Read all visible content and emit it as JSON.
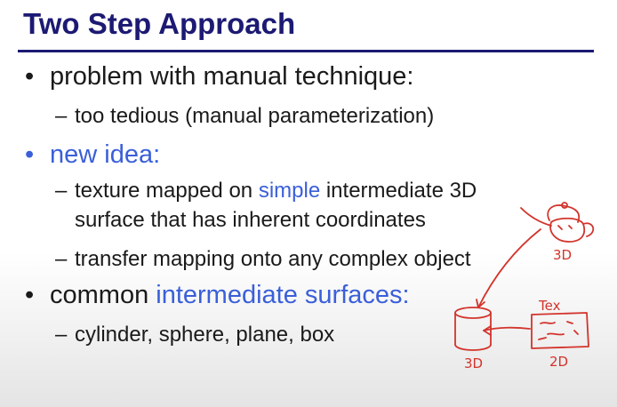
{
  "slide": {
    "title": "Two Step Approach",
    "bullets": [
      {
        "text": "problem with manual technique:",
        "subitems": [
          {
            "text": "too tedious (manual parameterization)"
          }
        ]
      },
      {
        "text": "new idea:",
        "subitems": [
          {
            "part1": "texture mapped on ",
            "highlight": "simple",
            "part2": " intermediate 3D",
            "line2": "surface that has inherent coordinates"
          },
          {
            "text": "transfer mapping onto any complex object"
          }
        ]
      },
      {
        "part1": "common ",
        "highlight": "intermediate surfaces:",
        "subitems": [
          {
            "text": "cylinder, sphere, plane, box"
          }
        ]
      }
    ],
    "colors": {
      "title": "#1c1a73",
      "highlight": "#3a5fd9",
      "annotation": "#d2342c"
    }
  },
  "annotations": {
    "teapot_label": "3D",
    "cylinder_label": "3D",
    "texture_label": "Tex",
    "texture_dim_label": "2D"
  }
}
